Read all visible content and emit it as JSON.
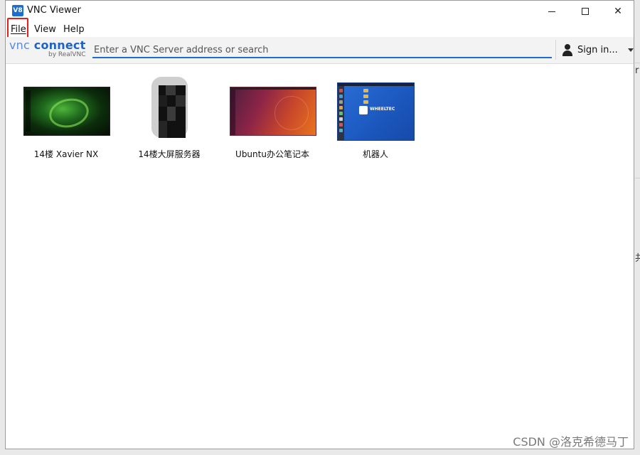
{
  "window": {
    "title": "VNC Viewer",
    "app_icon": "V8",
    "controls": {
      "minimize": "minimize",
      "maximize": "maximize",
      "close": "✕"
    }
  },
  "menu": {
    "file": "File",
    "view": "View",
    "help": "Help"
  },
  "toolbar": {
    "logo_main_a": "vnc",
    "logo_main_b": "connect",
    "logo_sub": "by RealVNC",
    "search_placeholder": "Enter a VNC Server address or search",
    "search_value": "",
    "sign_in_label": "Sign in..."
  },
  "address_book": [
    {
      "label": "14楼 Xavier NX",
      "thumbnail": "nvidia-desktop"
    },
    {
      "label": "14楼大屏服务器",
      "thumbnail": "blurred-screen"
    },
    {
      "label": "Ubuntu办公笔记本",
      "thumbnail": "ubuntu-desktop"
    },
    {
      "label": "机器人",
      "thumbnail": "wheeltec-desktop"
    }
  ],
  "thumbnail_text": {
    "robot_brand": "WHEELTEC"
  },
  "watermark": "CSDN @洛克希德马丁",
  "colors": {
    "accent": "#1e6dd6",
    "highlight_border": "#e0211c"
  }
}
